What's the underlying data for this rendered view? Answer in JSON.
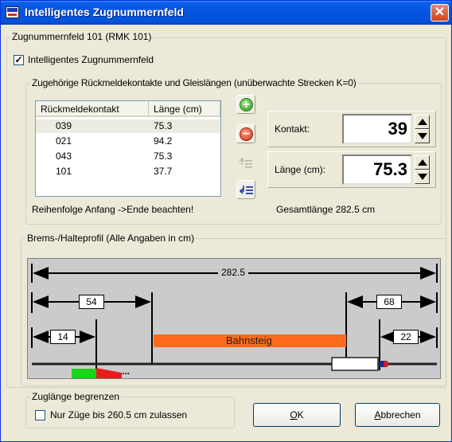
{
  "window": {
    "title": "Intelligentes Zugnummernfeld",
    "close_glyph": "✕"
  },
  "group_main": {
    "legend": "Zugnummernfeld 101 (RMK 101)"
  },
  "intelligent_checkbox": {
    "label": "Intelligentes Zugnummernfeld",
    "checked": true,
    "mark": "✓"
  },
  "contacts_group": {
    "legend": "Zugehörige Rückmeldekontakte und Gleislängen (unüberwachte Strecken K=0)",
    "columns": [
      "Rückmeldekontakt",
      "Länge (cm)"
    ],
    "rows": [
      {
        "contact": "039",
        "length": "75.3"
      },
      {
        "contact": "021",
        "length": "94.2"
      },
      {
        "contact": "043",
        "length": "75.3"
      },
      {
        "contact": "101",
        "length": "37.7"
      }
    ],
    "add_glyph": "+",
    "remove_glyph": "−",
    "hint": "Reihenfolge Anfang ->Ende beachten!",
    "total": "Gesamtlänge 282.5 cm"
  },
  "contact_field": {
    "label": "Kontakt:",
    "value": "39"
  },
  "length_field": {
    "label": "Länge (cm):",
    "value": "75.3"
  },
  "profile_group": {
    "legend": "Brems-/Halteprofil (Alle Angaben in cm)",
    "total_length": "282.5",
    "left_brake": "54",
    "left_stop": "14",
    "right_brake": "68",
    "right_stop": "22",
    "platform_label": "Bahnsteig",
    "train_tail": "...",
    "colors": {
      "platform": "#ff6a1a",
      "signal_green": "#19d419",
      "signal_red": "#e81c1c"
    }
  },
  "limit_group": {
    "legend": "Zuglänge begrenzen",
    "checkbox_label": "Nur Züge bis 260.5 cm zulassen",
    "checked": false
  },
  "buttons": {
    "ok_mnemonic": "O",
    "ok_rest": "K",
    "cancel_mnemonic": "A",
    "cancel_rest": "bbrechen"
  }
}
